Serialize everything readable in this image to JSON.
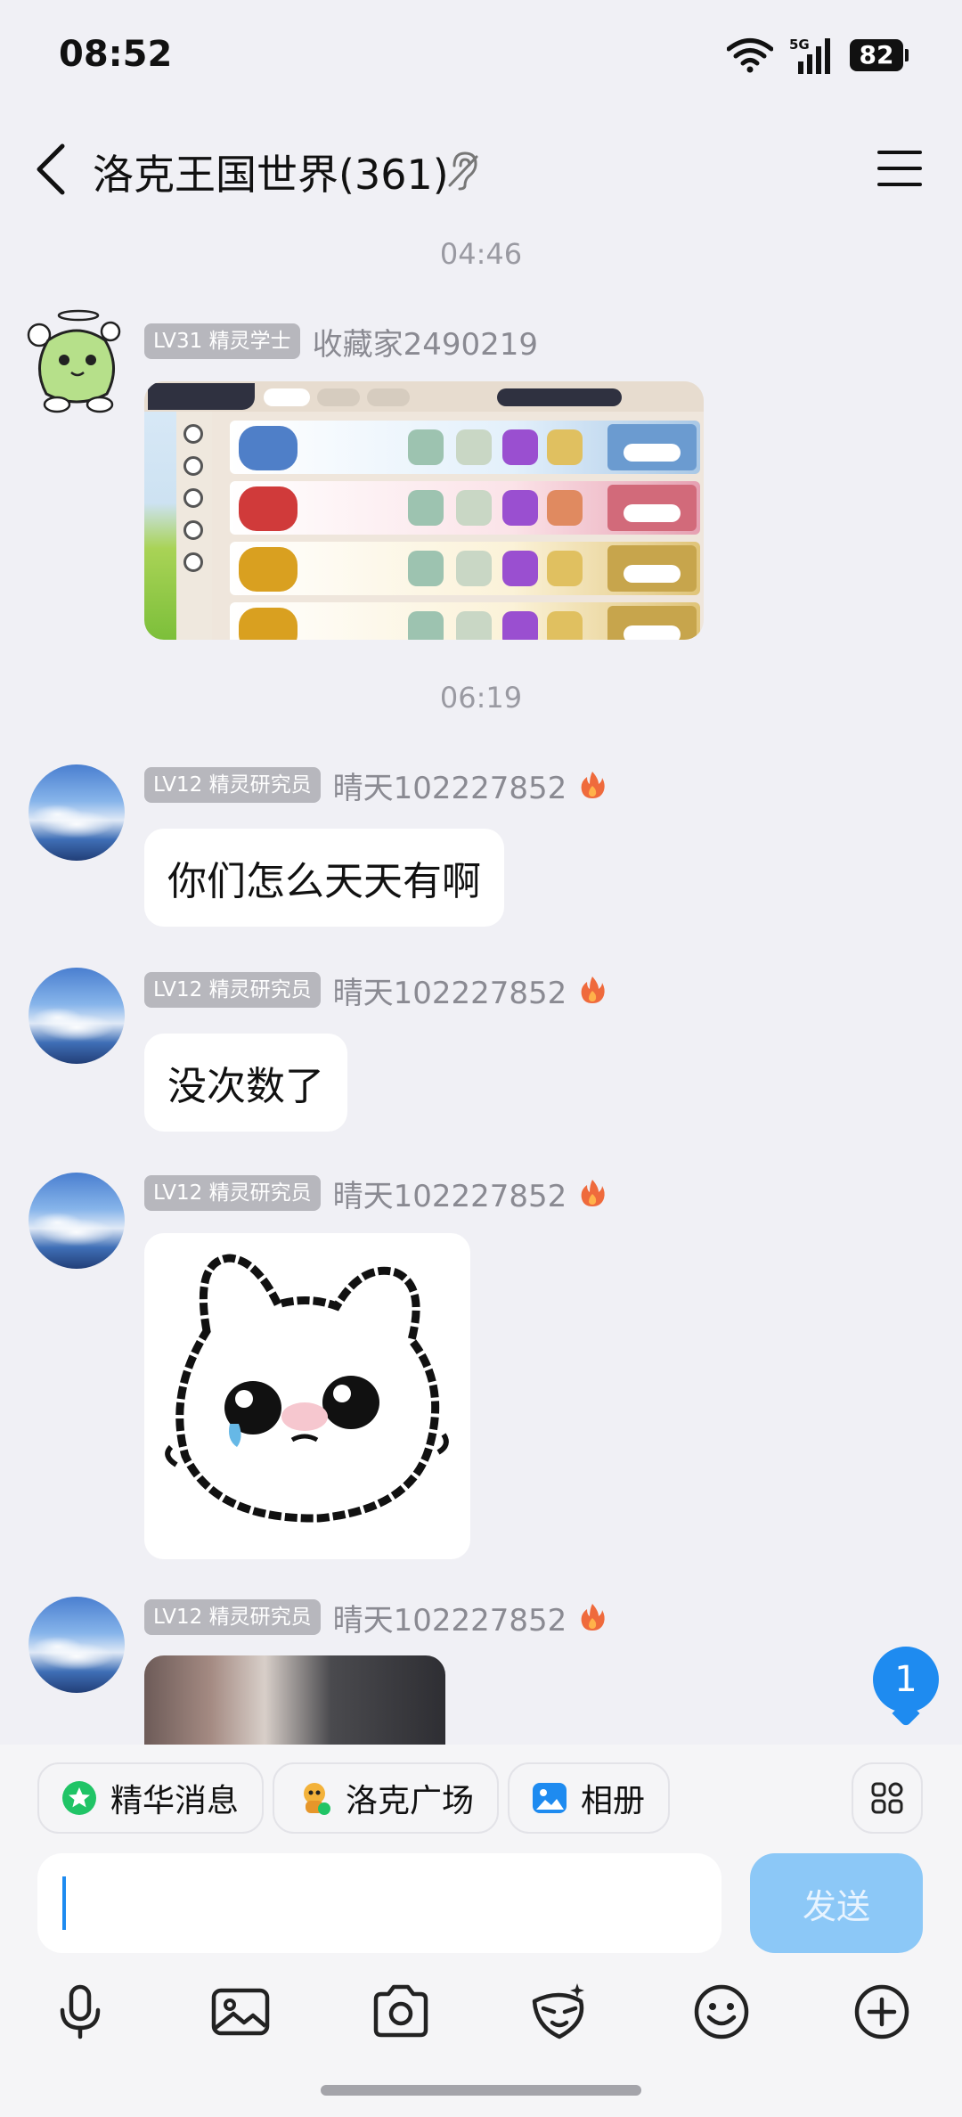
{
  "status_bar": {
    "time": "08:52",
    "network": "5G",
    "battery": "82"
  },
  "header": {
    "title": "洛克王国世界(361)"
  },
  "timestamps": [
    "04:46",
    "06:19"
  ],
  "messages": [
    {
      "level": "LV31 精灵学士",
      "sender": "收藏家2490219",
      "type": "image"
    },
    {
      "level": "LV12 精灵研究员",
      "sender": "晴天102227852",
      "type": "text",
      "text": "你们怎么天天有啊"
    },
    {
      "level": "LV12 精灵研究员",
      "sender": "晴天102227852",
      "type": "text",
      "text": "没次数了"
    },
    {
      "level": "LV12 精灵研究员",
      "sender": "晴天102227852",
      "type": "sticker"
    },
    {
      "level": "LV12 精灵研究员",
      "sender": "晴天102227852",
      "type": "image"
    }
  ],
  "unread_count": "1",
  "quick_bar": {
    "chips": [
      {
        "label": "精华消息",
        "icon": "star-icon"
      },
      {
        "label": "洛克广场",
        "icon": "mascot-icon"
      },
      {
        "label": "相册",
        "icon": "photo-icon"
      }
    ]
  },
  "composer": {
    "value": "",
    "send_label": "发送"
  },
  "toolbar": [
    "mic-icon",
    "image-icon",
    "camera-icon",
    "effects-icon",
    "emoji-icon",
    "plus-icon"
  ],
  "colors": {
    "accent": "#1e8bf0",
    "send_disabled": "#8cc8f7",
    "badge": "#b7b7bd"
  }
}
